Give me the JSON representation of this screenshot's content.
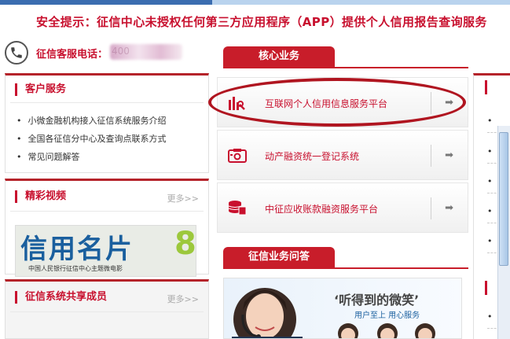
{
  "alert": {
    "text": "安全提示：征信中心未授权任何第三方应用程序（APP）提供个人信用报告查询服务"
  },
  "hotline": {
    "label": "征信客服电话：",
    "number_masked": "400"
  },
  "customer_service": {
    "title": "客户服务",
    "items": [
      "小微金融机构接入征信系统服务介绍",
      "全国各征信分中心及查询点联系方式",
      "常见问题解答"
    ]
  },
  "video": {
    "title": "精彩视频",
    "more": "更多>>",
    "thumb_title": "信用名片",
    "thumb_subtitle": "中国人民银行征信中心主题微电影"
  },
  "members": {
    "title": "征信系统共享成员",
    "more": "更多>>"
  },
  "core_business": {
    "tab": "核心业务",
    "services": [
      {
        "label": "互联网个人信用信息服务平台",
        "icon": "building-chart-icon",
        "highlighted": true
      },
      {
        "label": "动产融资统一登记系统",
        "icon": "registry-icon",
        "highlighted": false
      },
      {
        "label": "中征应收账款融资服务平台",
        "icon": "coins-icon",
        "highlighted": false
      }
    ],
    "arrow": "➡"
  },
  "qa": {
    "tab": "征信业务问答",
    "banner_quote": "‘听得到的微笑’",
    "banner_slogan": "用户至上 用心服务"
  },
  "colors": {
    "brand_red": "#c8102e",
    "tab_red": "#c81d2a",
    "link_blue": "#1a5f9e"
  }
}
